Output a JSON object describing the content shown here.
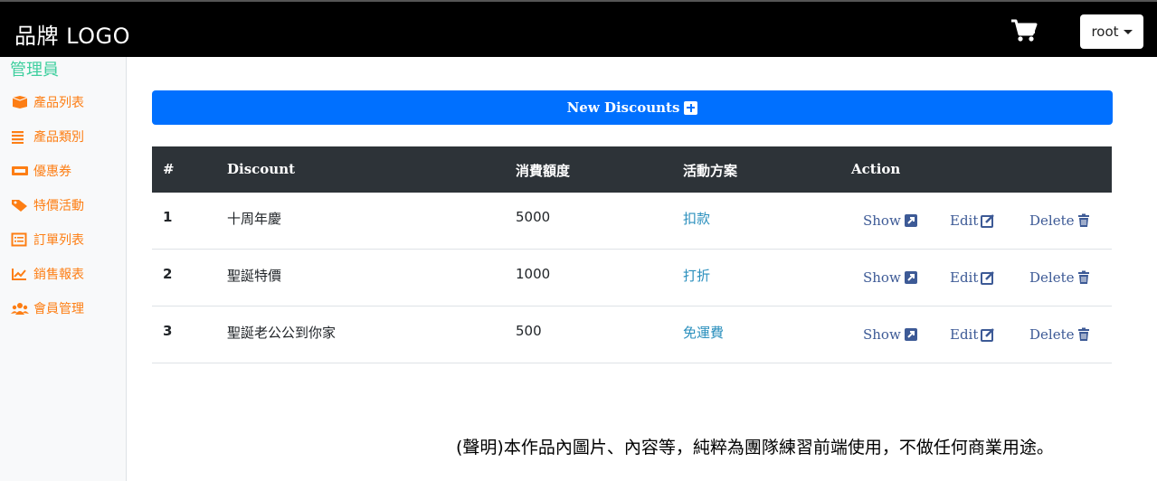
{
  "navbar": {
    "brand": "品牌 LOGO",
    "cart_icon": "shopping-cart-icon",
    "user_label": "root"
  },
  "sidebar": {
    "title": "管理員",
    "items": [
      {
        "label": "產品列表",
        "icon": "box-icon"
      },
      {
        "label": "產品類別",
        "icon": "list-icon"
      },
      {
        "label": "優惠券",
        "icon": "ticket-icon"
      },
      {
        "label": "特價活動",
        "icon": "tags-icon"
      },
      {
        "label": "訂單列表",
        "icon": "list-alt-icon"
      },
      {
        "label": "銷售報表",
        "icon": "chart-line-icon"
      },
      {
        "label": "會員管理",
        "icon": "users-icon"
      }
    ],
    "accent_color": "#fd7e14",
    "title_color": "#3ecf9e"
  },
  "main": {
    "new_button_label": "New Discounts",
    "table": {
      "headers": [
        "#",
        "Discount",
        "消費額度",
        "活動方案",
        "Action"
      ],
      "rows": [
        {
          "num": "1",
          "discount": "十周年慶",
          "amount": "5000",
          "plan": "扣款"
        },
        {
          "num": "2",
          "discount": "聖誕特價",
          "amount": "1000",
          "plan": "打折"
        },
        {
          "num": "3",
          "discount": "聖誕老公公到你家",
          "amount": "500",
          "plan": "免運費"
        }
      ],
      "actions": {
        "show": "Show",
        "edit": "Edit",
        "delete": "Delete"
      }
    }
  },
  "footer": {
    "note": "(聲明)本作品內圖片、內容等，純粹為團隊練習前端使用，不做任何商業用途。"
  }
}
